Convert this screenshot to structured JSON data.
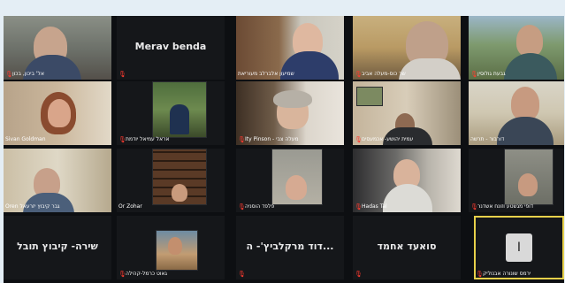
{
  "tiles": [
    {
      "label": "אל' ביכון, בכון",
      "mic": true
    },
    {
      "label": "",
      "big": "Merav benda",
      "mic": true
    },
    {
      "label": "שמיעון אלברלב מעוריאת",
      "mic": false
    },
    {
      "label": "שר כוס-מעלה אביב",
      "mic": true
    },
    {
      "label": "גבעת גולוסין",
      "mic": true
    },
    {
      "label": "Sivan Goldman",
      "mic": true
    },
    {
      "label": "אראל עמיאל יודמת",
      "mic": true
    },
    {
      "label": "Ity Pinson - מעלה צבי",
      "mic": true
    },
    {
      "label": "עמית יהושע- אכמעסים",
      "mic": true
    },
    {
      "label": "דורבור - תרשה",
      "mic": true
    },
    {
      "label": "Oren גבר קיבוץ יזרעאל",
      "mic": false
    },
    {
      "label": "Or Zohar",
      "mic": false
    },
    {
      "label": "פלפד הוסניה",
      "mic": true
    },
    {
      "label": "Hadas Tal",
      "mic": true
    },
    {
      "label": "דופי מגשטע וזונח אשדנר",
      "mic": true
    },
    {
      "label": "",
      "big": "שירה- קיבוץ תובל",
      "mic": false
    },
    {
      "label": "גאוט כרמל-קהילה",
      "mic": true
    },
    {
      "label": "",
      "big": "דוד מרקלביץ'- ה...",
      "mic": true
    },
    {
      "label": "",
      "big": "סואעד אחמד",
      "mic": true
    },
    {
      "label": "ירמס שונורה אבנוליק",
      "mic": true,
      "avatar": "I"
    }
  ]
}
